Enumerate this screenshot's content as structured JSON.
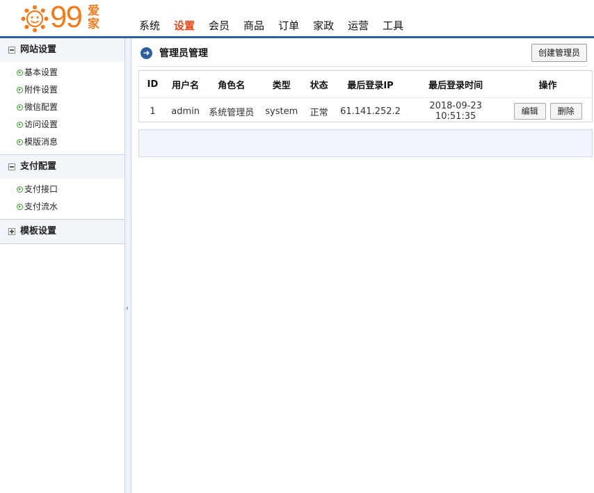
{
  "header": {
    "logo_number": "99",
    "logo_text": "爱家",
    "nav": [
      {
        "label": "系统",
        "active": false
      },
      {
        "label": "设置",
        "active": true
      },
      {
        "label": "会员",
        "active": false
      },
      {
        "label": "商品",
        "active": false
      },
      {
        "label": "订单",
        "active": false
      },
      {
        "label": "家政",
        "active": false
      },
      {
        "label": "运营",
        "active": false
      },
      {
        "label": "工具",
        "active": false
      }
    ]
  },
  "sidebar": {
    "groups": [
      {
        "title": "网站设置",
        "expanded": true,
        "items": [
          "基本设置",
          "附件设置",
          "微信配置",
          "访问设置",
          "模版消息"
        ]
      },
      {
        "title": "支付配置",
        "expanded": true,
        "items": [
          "支付接口",
          "支付流水"
        ]
      },
      {
        "title": "模板设置",
        "expanded": false,
        "items": []
      }
    ],
    "collapse_glyph": "‹"
  },
  "main": {
    "title": "管理员管理",
    "create_button": "创建管理员",
    "table": {
      "columns": [
        "ID",
        "用户名",
        "角色名",
        "类型",
        "状态",
        "最后登录IP",
        "最后登录时间",
        "操作"
      ],
      "rows": [
        {
          "id": "1",
          "username": "admin",
          "role": "系统管理员",
          "type": "system",
          "status": "正常",
          "last_ip": "61.141.252.2",
          "last_time": "2018-09-23 10:51:35",
          "edit": "编辑",
          "delete": "删除"
        }
      ]
    }
  },
  "colors": {
    "accent": "#2f5f9b",
    "nav_active": "#e5461a",
    "logo": "#f07c1e"
  }
}
